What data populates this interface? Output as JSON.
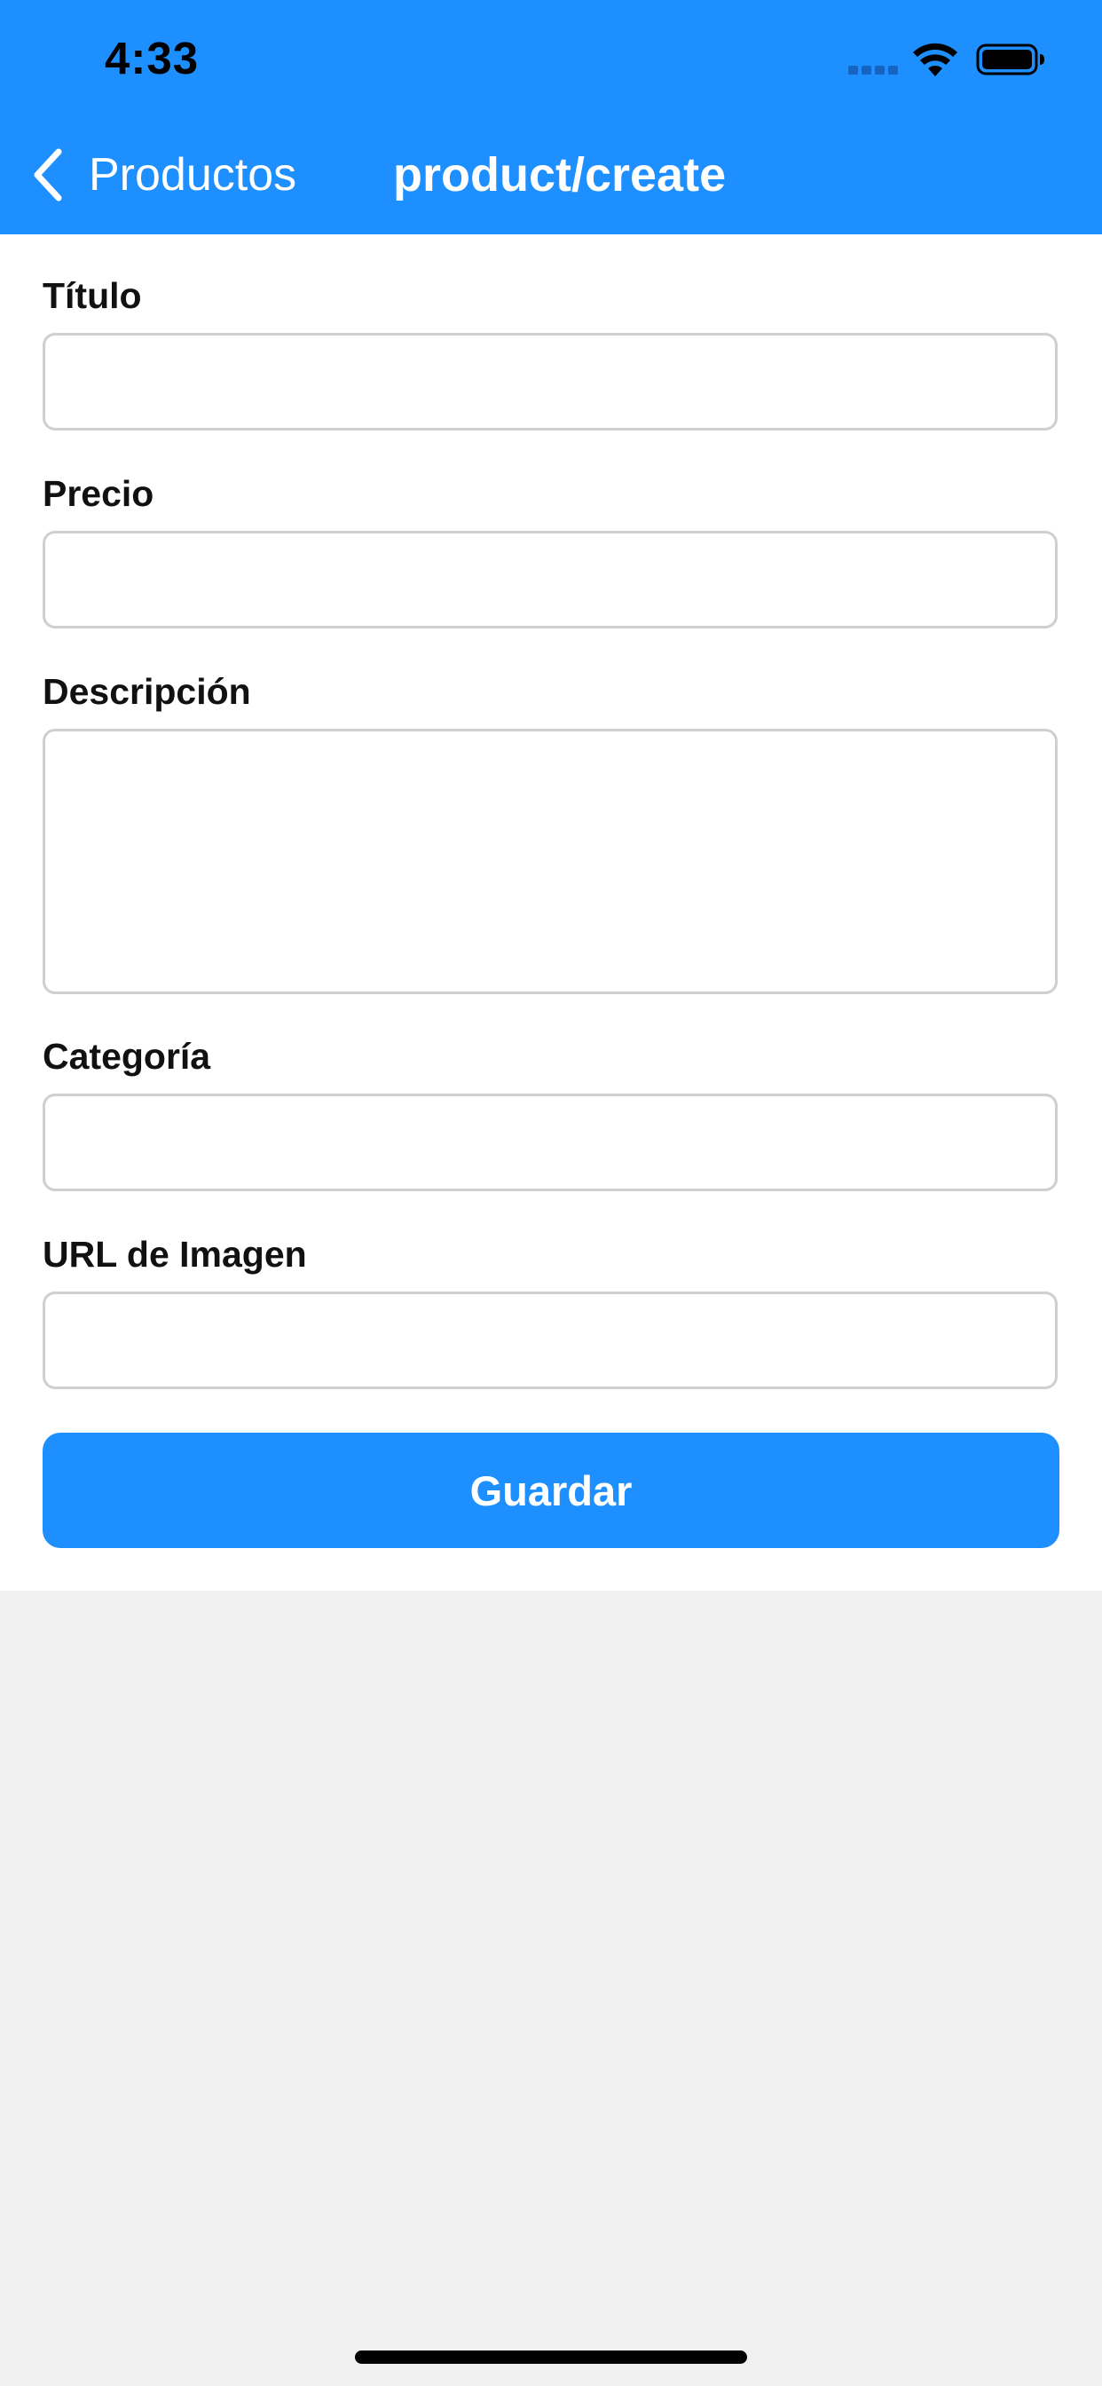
{
  "status_bar": {
    "time": "4:33"
  },
  "nav": {
    "back_label": "Productos",
    "title": "product/create"
  },
  "form": {
    "fields": [
      {
        "label": "Título",
        "value": "",
        "placeholder": ""
      },
      {
        "label": "Precio",
        "value": "",
        "placeholder": ""
      },
      {
        "label": "Descripción",
        "value": "",
        "placeholder": ""
      },
      {
        "label": "Categoría",
        "value": "",
        "placeholder": ""
      },
      {
        "label": "URL de Imagen",
        "value": "",
        "placeholder": ""
      }
    ],
    "save_label": "Guardar"
  },
  "colors": {
    "accent": "#1e8ffe",
    "background": "#f0f0f0",
    "input_border": "#cfcfcf"
  },
  "icons": {
    "back": "chevron-left-icon",
    "signal": "cellular-signal-icon",
    "wifi": "wifi-icon",
    "battery": "battery-icon"
  }
}
